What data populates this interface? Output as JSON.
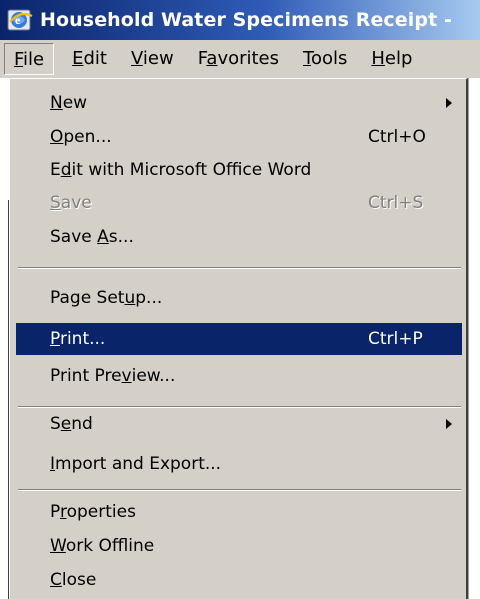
{
  "window": {
    "title": "Household Water Specimens Receipt -"
  },
  "menubar": {
    "items": [
      {
        "before": "",
        "key": "F",
        "after": "ile"
      },
      {
        "before": "",
        "key": "E",
        "after": "dit"
      },
      {
        "before": "",
        "key": "V",
        "after": "iew"
      },
      {
        "before": "F",
        "key": "a",
        "after": "vorites"
      },
      {
        "before": "",
        "key": "T",
        "after": "ools"
      },
      {
        "before": "",
        "key": "H",
        "after": "elp"
      }
    ]
  },
  "file_menu": {
    "items": [
      {
        "before": "",
        "key": "N",
        "after": "ew",
        "shortcut": ""
      },
      {
        "before": "",
        "key": "O",
        "after": "pen...",
        "shortcut": "Ctrl+O"
      },
      {
        "before": "E",
        "key": "d",
        "after": "it with Microsoft Office Word",
        "shortcut": ""
      },
      {
        "before": "",
        "key": "S",
        "after": "ave",
        "shortcut": "Ctrl+S"
      },
      {
        "before": "Save ",
        "key": "A",
        "after": "s...",
        "shortcut": ""
      },
      {
        "before": "Page Set",
        "key": "u",
        "after": "p...",
        "shortcut": ""
      },
      {
        "before": "",
        "key": "P",
        "after": "rint...",
        "shortcut": "Ctrl+P"
      },
      {
        "before": "Print Pre",
        "key": "v",
        "after": "iew...",
        "shortcut": ""
      },
      {
        "before": "S",
        "key": "e",
        "after": "nd",
        "shortcut": ""
      },
      {
        "before": "",
        "key": "I",
        "after": "mport and Export...",
        "shortcut": ""
      },
      {
        "before": "P",
        "key": "r",
        "after": "operties",
        "shortcut": ""
      },
      {
        "before": "",
        "key": "W",
        "after": "ork Offline",
        "shortcut": ""
      },
      {
        "before": "",
        "key": "C",
        "after": "lose",
        "shortcut": ""
      }
    ]
  },
  "colors": {
    "highlight": "#0a246a",
    "menu_bg": "#d4d0c8",
    "disabled_text": "#808080"
  },
  "icons": {
    "app": "internet-explorer-icon",
    "submenu": "submenu-arrow-icon"
  }
}
